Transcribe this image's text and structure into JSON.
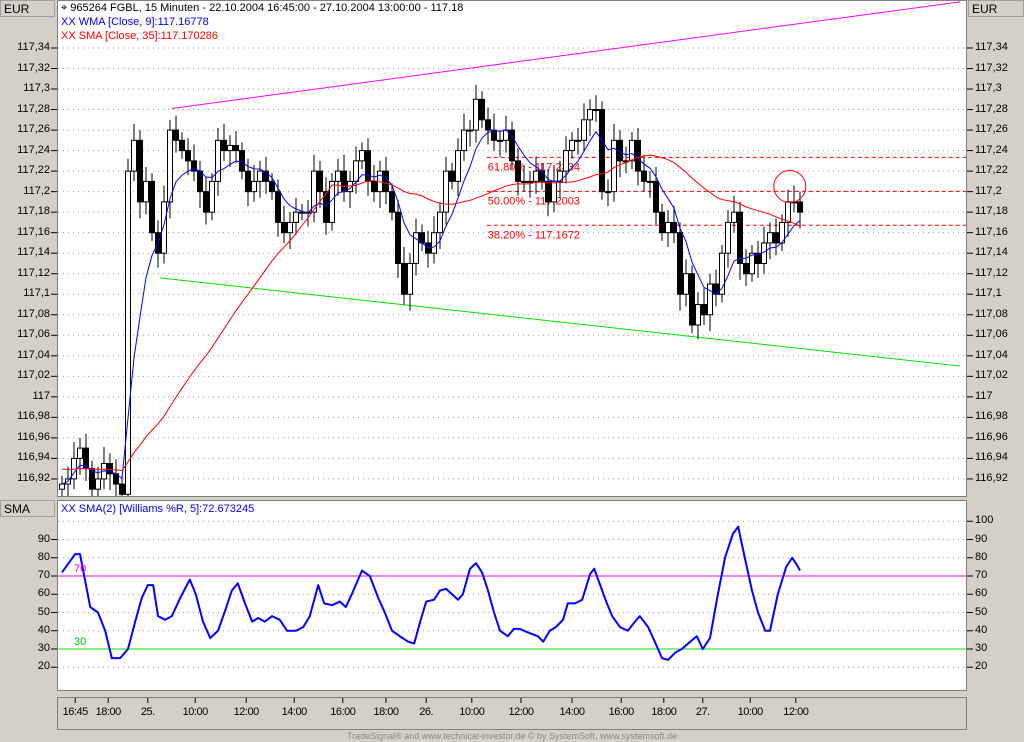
{
  "header": {
    "currency_left": "EUR",
    "currency_right": "EUR",
    "title": "965264  FGBL, 15 Minuten - 22.10.2004 16:45:00 - 27.10.2004 13:00:00 - 117.18",
    "wma_legend": "XX WMA [Close, 9]:117.16778",
    "sma_legend": "XX SMA [Close, 35]:117.170286"
  },
  "indicator": {
    "axis_label": "SMA",
    "legend": "XX SMA(2) [Williams %R, 5]:72.673245",
    "level_70_label": "70",
    "level_30_label": "30"
  },
  "footer": "TradeSignal® and www.technical-investor.de © by SystemSoft, www.systemsoft.de",
  "colors": {
    "wma": "#0000ff",
    "sma": "#ff0000",
    "upper_trend": "#ff00ff",
    "lower_trend": "#00e000",
    "fib": "#ff0000",
    "level70": "#ff00ff",
    "level30": "#00e000"
  },
  "chart_data": [
    {
      "type": "candlestick",
      "title": "965264 FGBL, 15 Minuten",
      "ylim": [
        116.9,
        117.39
      ],
      "y_ticks": [
        "117,34",
        "117,32",
        "117,3",
        "117,28",
        "117,26",
        "117,24",
        "117,22",
        "117,2",
        "117,18",
        "117,16",
        "117,14",
        "117,12",
        "117,1",
        "117,08",
        "117,06",
        "117,04",
        "117,02",
        "117",
        "116,98",
        "116,96",
        "116,94",
        "116,92"
      ],
      "y_tick_values": [
        117.34,
        117.32,
        117.3,
        117.28,
        117.26,
        117.24,
        117.22,
        117.2,
        117.18,
        117.16,
        117.14,
        117.12,
        117.1,
        117.08,
        117.06,
        117.04,
        117.02,
        117.0,
        116.98,
        116.96,
        116.94,
        116.92
      ],
      "first_open": 116.91,
      "close": [
        116.915,
        116.92,
        116.94,
        116.95,
        116.93,
        116.91,
        116.92,
        116.935,
        116.925,
        116.915,
        116.905,
        117.22,
        117.25,
        117.19,
        117.21,
        117.16,
        117.14,
        117.19,
        117.26,
        117.25,
        117.24,
        117.23,
        117.22,
        117.2,
        117.18,
        117.21,
        117.25,
        117.24,
        117.245,
        117.24,
        117.22,
        117.2,
        117.21,
        117.22,
        117.21,
        117.2,
        117.17,
        117.16,
        117.17,
        117.18,
        117.18,
        117.18,
        117.22,
        117.2,
        117.17,
        117.21,
        117.22,
        117.2,
        117.21,
        117.23,
        117.24,
        117.21,
        117.2,
        117.22,
        117.2,
        117.18,
        117.13,
        117.1,
        117.13,
        117.16,
        117.15,
        117.14,
        117.16,
        117.18,
        117.22,
        117.21,
        117.24,
        117.26,
        117.26,
        117.29,
        117.27,
        117.26,
        117.25,
        117.25,
        117.26,
        117.23,
        117.21,
        117.21,
        117.21,
        117.22,
        117.21,
        117.19,
        117.21,
        117.22,
        117.24,
        117.25,
        117.25,
        117.27,
        117.28,
        117.28,
        117.2,
        117.2,
        117.25,
        117.23,
        117.23,
        117.25,
        117.22,
        117.21,
        117.21,
        117.18,
        117.16,
        117.17,
        117.16,
        117.1,
        117.12,
        117.07,
        117.09,
        117.08,
        117.11,
        117.1,
        117.14,
        117.17,
        117.18,
        117.13,
        117.12,
        117.14,
        117.13,
        117.15,
        117.16,
        117.15,
        117.17,
        117.19,
        117.19,
        117.18
      ],
      "wma_period": 9,
      "sma_period": 35,
      "upper_trendline": [
        [
          18.3,
          117.281
        ],
        [
          149.7,
          117.385
        ]
      ],
      "lower_trendline": [
        [
          16.3,
          117.116
        ],
        [
          149.7,
          117.03
        ]
      ],
      "fibonacci": {
        "start_bar": 70.8,
        "levels": [
          {
            "label": "61.80% - 117.2334",
            "value": 117.2334
          },
          {
            "label": "50.00% - 117.2003",
            "value": 117.2003
          },
          {
            "label": "38.20% - 117.1672",
            "value": 117.1672
          }
        ]
      },
      "highlight_circle": {
        "bar": 121.3,
        "value": 117.205
      },
      "x_ticks": [
        {
          "label": "16:45",
          "bar": 2.2
        },
        {
          "label": "18:00",
          "bar": 7.7
        },
        {
          "label": "25.",
          "bar": 14.3
        },
        {
          "label": "10:00",
          "bar": 22.2
        },
        {
          "label": "12:00",
          "bar": 30.7
        },
        {
          "label": "14:00",
          "bar": 38.7
        },
        {
          "label": "16:00",
          "bar": 46.8
        },
        {
          "label": "18:00",
          "bar": 54
        },
        {
          "label": "26.",
          "bar": 60.7
        },
        {
          "label": "10:00",
          "bar": 68.3
        },
        {
          "label": "12:00",
          "bar": 76.5
        },
        {
          "label": "14:00",
          "bar": 85
        },
        {
          "label": "16:00",
          "bar": 93.2
        },
        {
          "label": "18:00",
          "bar": 100.3
        },
        {
          "label": "27.",
          "bar": 106.8
        },
        {
          "label": "10:00",
          "bar": 114.7
        },
        {
          "label": "12:00",
          "bar": 122.3
        }
      ]
    },
    {
      "type": "line",
      "title": "SMA(2) [Williams %R, 5]",
      "ylim": [
        12,
        105
      ],
      "y_ticks_right": [
        "100",
        "90",
        "80",
        "70",
        "60",
        "50",
        "40",
        "30",
        "20"
      ],
      "y_ticks_left": [
        "90",
        "80",
        "70",
        "60",
        "50",
        "40",
        "30",
        "20"
      ],
      "y_tick_values_right": [
        100,
        90,
        80,
        70,
        60,
        50,
        40,
        30,
        20
      ],
      "y_tick_values_left": [
        90,
        80,
        70,
        60,
        50,
        40,
        30,
        20
      ],
      "levels": [
        70,
        30
      ],
      "points": [
        [
          0,
          72
        ],
        [
          2.2,
          82
        ],
        [
          3,
          82
        ],
        [
          4.7,
          53
        ],
        [
          6,
          50
        ],
        [
          7.2,
          40
        ],
        [
          8.3,
          25
        ],
        [
          9.7,
          25
        ],
        [
          11,
          30
        ],
        [
          12.2,
          45
        ],
        [
          13.3,
          58
        ],
        [
          14.3,
          65
        ],
        [
          15.2,
          65
        ],
        [
          16,
          48
        ],
        [
          17.2,
          46
        ],
        [
          18.3,
          48
        ],
        [
          19.7,
          58
        ],
        [
          21.3,
          68
        ],
        [
          22.3,
          60
        ],
        [
          23.5,
          45
        ],
        [
          24.7,
          36
        ],
        [
          26,
          40
        ],
        [
          27.3,
          52
        ],
        [
          28.3,
          62
        ],
        [
          29.3,
          66
        ],
        [
          30.5,
          55
        ],
        [
          31.7,
          45
        ],
        [
          32.7,
          47
        ],
        [
          33.8,
          45
        ],
        [
          35,
          48
        ],
        [
          36.3,
          46
        ],
        [
          37.5,
          40
        ],
        [
          39,
          40
        ],
        [
          40.2,
          42
        ],
        [
          41.3,
          48
        ],
        [
          42.7,
          65
        ],
        [
          43.7,
          55
        ],
        [
          45,
          54
        ],
        [
          46.3,
          56
        ],
        [
          47.3,
          53
        ],
        [
          48.3,
          60
        ],
        [
          50,
          73
        ],
        [
          51.3,
          70
        ],
        [
          52.7,
          58
        ],
        [
          53.8,
          50
        ],
        [
          55,
          40
        ],
        [
          56.3,
          37
        ],
        [
          57.7,
          34
        ],
        [
          58.7,
          33
        ],
        [
          59.7,
          45
        ],
        [
          60.7,
          56
        ],
        [
          62,
          57
        ],
        [
          63,
          62
        ],
        [
          64,
          63
        ],
        [
          65,
          60
        ],
        [
          66,
          57
        ],
        [
          66.8,
          60
        ],
        [
          68,
          74
        ],
        [
          69,
          77
        ],
        [
          70,
          72
        ],
        [
          71,
          62
        ],
        [
          72,
          50
        ],
        [
          73,
          40
        ],
        [
          74.3,
          37
        ],
        [
          75.3,
          41
        ],
        [
          76.3,
          41
        ],
        [
          77.7,
          39
        ],
        [
          79.3,
          37
        ],
        [
          80.2,
          34
        ],
        [
          81.3,
          40
        ],
        [
          82.3,
          42
        ],
        [
          83.5,
          46
        ],
        [
          84.3,
          55
        ],
        [
          85.5,
          55
        ],
        [
          86.7,
          57
        ],
        [
          88,
          71
        ],
        [
          88.7,
          74
        ],
        [
          89.7,
          65
        ],
        [
          90.7,
          56
        ],
        [
          91.7,
          48
        ],
        [
          93,
          42
        ],
        [
          94.3,
          40
        ],
        [
          95.5,
          45
        ],
        [
          96.3,
          48
        ],
        [
          97.7,
          42
        ],
        [
          98.8,
          34
        ],
        [
          100,
          25
        ],
        [
          101,
          24
        ],
        [
          102.2,
          28
        ],
        [
          103.3,
          30
        ],
        [
          104.7,
          34
        ],
        [
          105.8,
          37
        ],
        [
          106.8,
          30
        ],
        [
          108,
          36
        ],
        [
          109.2,
          58
        ],
        [
          110.5,
          80
        ],
        [
          111.8,
          93
        ],
        [
          112.7,
          97
        ],
        [
          113.8,
          80
        ],
        [
          115,
          62
        ],
        [
          116,
          50
        ],
        [
          117.2,
          40
        ],
        [
          118,
          40
        ],
        [
          119.3,
          60
        ],
        [
          120.7,
          75
        ],
        [
          121.7,
          80
        ],
        [
          122.5,
          76
        ],
        [
          123,
          73
        ]
      ]
    }
  ]
}
